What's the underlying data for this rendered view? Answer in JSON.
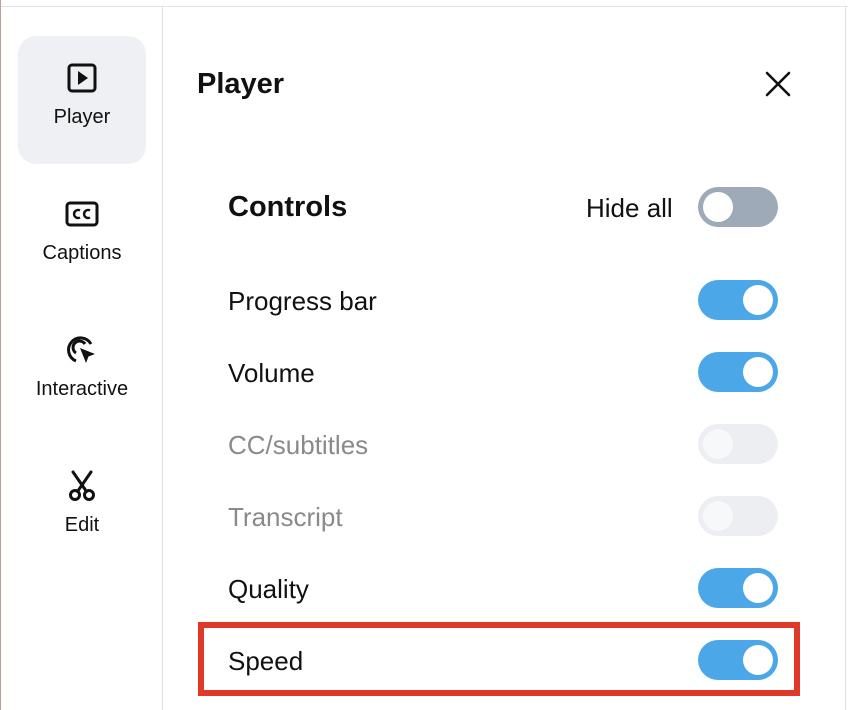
{
  "sidebar": {
    "items": [
      {
        "label": "Player",
        "icon": "play-square-icon",
        "active": true
      },
      {
        "label": "Captions",
        "icon": "cc-icon",
        "active": false
      },
      {
        "label": "Interactive",
        "icon": "cursor-click-icon",
        "active": false
      },
      {
        "label": "Edit",
        "icon": "scissors-icon",
        "active": false
      }
    ]
  },
  "panel": {
    "title": "Player",
    "close_icon": "close-icon"
  },
  "controls": {
    "title": "Controls",
    "hide_all_label": "Hide all",
    "hide_all_on": false,
    "rows": [
      {
        "label": "Progress bar",
        "enabled": true,
        "on": true
      },
      {
        "label": "Volume",
        "enabled": true,
        "on": true
      },
      {
        "label": "CC/subtitles",
        "enabled": false,
        "on": false
      },
      {
        "label": "Transcript",
        "enabled": false,
        "on": false
      },
      {
        "label": "Quality",
        "enabled": true,
        "on": true
      },
      {
        "label": "Speed",
        "enabled": true,
        "on": true
      }
    ]
  },
  "colors": {
    "toggle_on": "#4ba7e8",
    "toggle_off": "#9eaab8",
    "toggle_disabled": "#eceef1",
    "highlight": "#e0392a",
    "sidebar_active": "#eef0f3"
  }
}
